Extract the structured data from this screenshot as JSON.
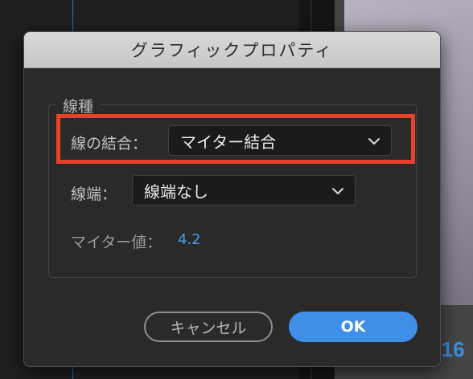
{
  "background": {
    "timecode": ":16"
  },
  "dialog": {
    "title": "グラフィックプロパティ",
    "group": {
      "legend": "線種",
      "join": {
        "label": "線の結合：",
        "value": "マイター結合"
      },
      "cap": {
        "label": "線端：",
        "value": "線端なし"
      },
      "miter": {
        "label": "マイター値：",
        "value": "4.2"
      }
    },
    "buttons": {
      "cancel": "キャンセル",
      "ok": "OK"
    }
  },
  "colors": {
    "accent": "#3f8ee8",
    "highlight": "#e6412b"
  },
  "icons": {
    "dropdown": "chevron-down-icon"
  }
}
